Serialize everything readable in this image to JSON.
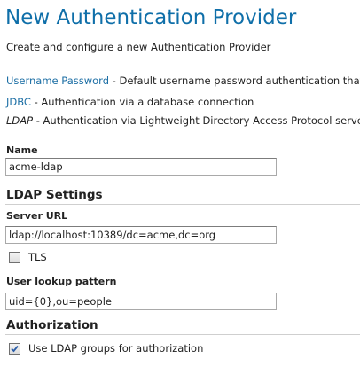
{
  "page": {
    "title": "New Authentication Provider",
    "subtitle": "Create and configure a new Authentication Provider"
  },
  "providers": [
    {
      "name": "Username Password",
      "description": " - Default username password authentication that wo",
      "link": true
    },
    {
      "name": "JDBC",
      "description": " - Authentication via a database connection",
      "link": true
    },
    {
      "name": "LDAP",
      "description": " - Authentication via Lightweight Directory Access Protocol server",
      "link": false
    }
  ],
  "name_field": {
    "label": "Name",
    "value": "acme-ldap"
  },
  "ldap_settings": {
    "heading": "LDAP Settings",
    "server_url": {
      "label": "Server URL",
      "value": "ldap://localhost:10389/dc=acme,dc=org"
    },
    "tls": {
      "label": "TLS",
      "checked": false
    },
    "user_lookup": {
      "label": "User lookup pattern",
      "value": "uid={0},ou=people"
    }
  },
  "authorization": {
    "heading": "Authorization",
    "use_groups": {
      "label": "Use LDAP groups for authorization",
      "checked": true
    }
  },
  "colors": {
    "title": "#0f6fa9",
    "link": "#1d6fa5",
    "text": "#222222",
    "checkmark": "#2a5da8"
  }
}
